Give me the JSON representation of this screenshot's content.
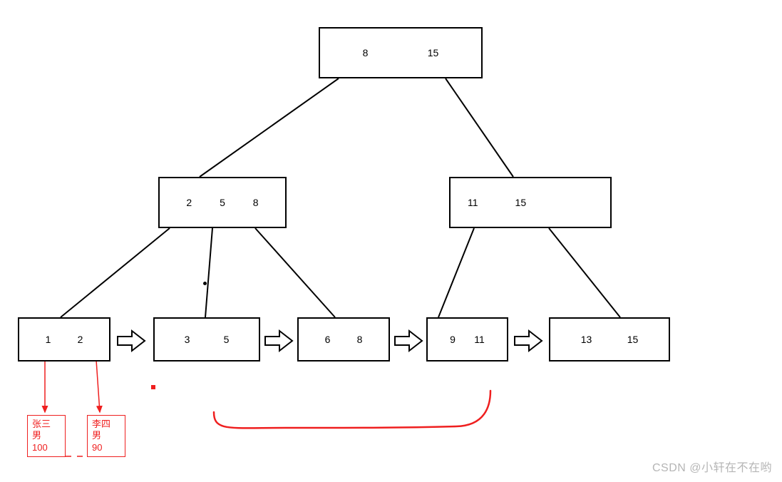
{
  "nodes": {
    "root": {
      "keys": [
        "8",
        "15"
      ]
    },
    "mid_left": {
      "keys": [
        "2",
        "5",
        "8"
      ]
    },
    "mid_right": {
      "keys": [
        "11",
        "15"
      ]
    },
    "leaf1": {
      "keys": [
        "1",
        "2"
      ]
    },
    "leaf2": {
      "keys": [
        "3",
        "5"
      ]
    },
    "leaf3": {
      "keys": [
        "6",
        "8"
      ]
    },
    "leaf4": {
      "keys": [
        "9",
        "11"
      ]
    },
    "leaf5": {
      "keys": [
        "13",
        "15"
      ]
    }
  },
  "records": {
    "rec1": {
      "name": "张三",
      "gender": "男",
      "score": "100"
    },
    "rec2": {
      "name": "李四",
      "gender": "男",
      "score": "90"
    }
  },
  "watermark": "CSDN @小轩在不在哟",
  "chart_data": {
    "type": "tree",
    "description": "B+ tree diagram with linked leaf nodes and record pointers",
    "root": {
      "keys": [
        8,
        15
      ]
    },
    "internal": [
      {
        "keys": [
          2,
          5,
          8
        ],
        "children": [
          "leaf1",
          "leaf2",
          "leaf3"
        ]
      },
      {
        "keys": [
          11,
          15
        ],
        "children": [
          "leaf4",
          "leaf5"
        ]
      }
    ],
    "leaves": [
      {
        "id": "leaf1",
        "keys": [
          1,
          2
        ],
        "next": "leaf2"
      },
      {
        "id": "leaf2",
        "keys": [
          3,
          5
        ],
        "next": "leaf3"
      },
      {
        "id": "leaf3",
        "keys": [
          6,
          8
        ],
        "next": "leaf4"
      },
      {
        "id": "leaf4",
        "keys": [
          9,
          11
        ],
        "next": "leaf5"
      },
      {
        "id": "leaf5",
        "keys": [
          13,
          15
        ],
        "next": null
      }
    ],
    "records": [
      {
        "from_leaf": "leaf1",
        "from_key": 1,
        "name": "张三",
        "gender": "男",
        "score": 100
      },
      {
        "from_leaf": "leaf1",
        "from_key": 2,
        "name": "李四",
        "gender": "男",
        "score": 90
      }
    ],
    "extra_curve": "hand-drawn red curve connecting under leaf2–leaf4 area"
  }
}
